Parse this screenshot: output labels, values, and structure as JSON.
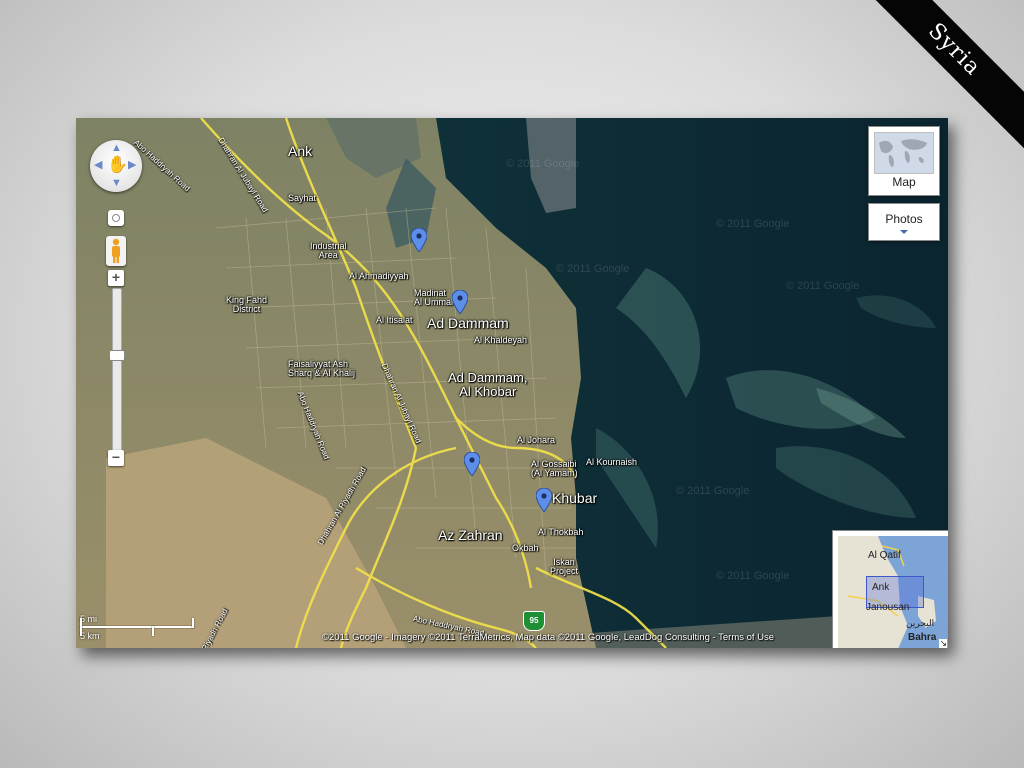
{
  "slide": {
    "corner_label": "Syria"
  },
  "controls": {
    "zoom_in": "+",
    "zoom_out": "−",
    "map_type": "Map",
    "photos": "Photos"
  },
  "places": {
    "ank": "Ank",
    "sayhat": "Sayhat",
    "industrial_area": "Industrial\nArea",
    "al_ahmadiyyah": "Al Ahmadiyyah",
    "madinat_al_ummal": "Madinat\nAl Ummal",
    "king_fahd_district": "King Fahd\nDistrict",
    "al_itisalat": "Al Itisalat",
    "ad_dammam": "Ad Dammam",
    "al_khaldeyah": "Al Khaldeyah",
    "faisaliyyat_ash_sharq": "Faisaliyyat Ash\nSharq & Al Khalij",
    "ad_dammam_al_khobar": "Ad Dammam,\nAl Khobar",
    "al_johara": "Al Johara",
    "al_gossaibi": "Al Gossaibi\n(Al Yamam)",
    "al_kournaish": "Al Kournaish",
    "khubar": "Khubar",
    "az_zahran": "Az Zahran",
    "al_thokbah": "Al Thokbah",
    "okbah": "Okbah",
    "iskan_project": "Iskan\nProject"
  },
  "roads": {
    "abo_haddryah_nw": "Abo Haddryah Road",
    "dhahran_al_jubayl_1": "Dhahran Al Jubayl Road",
    "abo_haddryah_mid": "Abo Haddryah Road",
    "dhahran_al_jubayl_2": "Dhahran Al Jubayl Road",
    "dhahran_al_riyadh": "Dhahran Al Riyadh Road",
    "abo_haddryah_s": "Abo Haddryah Road",
    "riyadh_road_sw": "Riyadh Road",
    "route_shield": "95"
  },
  "watermark": "© 2011 Google",
  "overview": {
    "al_qatif": "Al Qatif",
    "ank": "Ank",
    "janousan": "Janousan",
    "bahrain": "Bahra",
    "bahrain_ar": "البحرين"
  },
  "scale": {
    "miles": "5 mi",
    "km": "5 km"
  },
  "copyright": {
    "text": "©2011 Google - Imagery ©2011 TerraMetrics, Map data ©2011 Google, LeadDog Consulting - ",
    "terms": "Terms of Use"
  },
  "colors": {
    "sea": "#0e2b33",
    "land": "#8c8a6a",
    "desert": "#b59f74",
    "road_yellow": "#f2e14a",
    "pin_blue": "#5d8ee8",
    "banner": "#050505"
  }
}
